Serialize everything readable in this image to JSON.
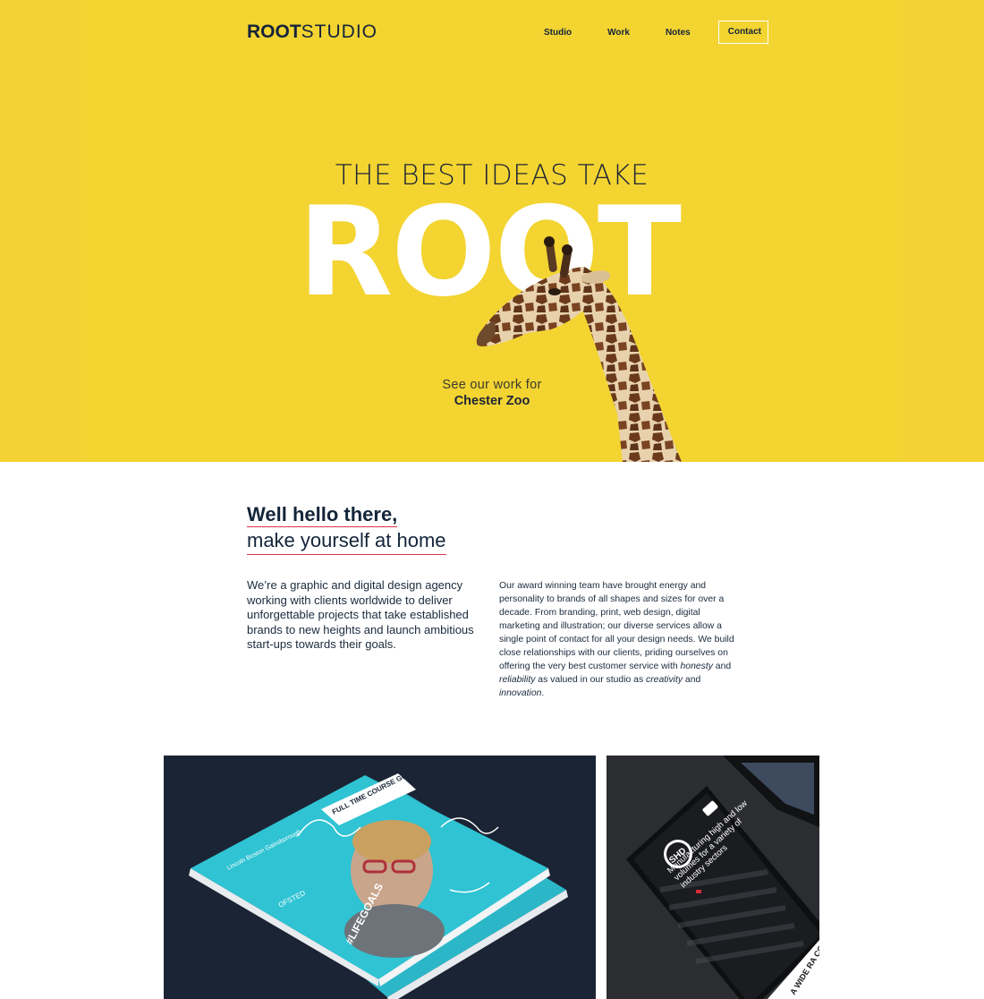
{
  "brand": {
    "logo_bold": "ROOT",
    "logo_light": "STUDIO"
  },
  "nav": {
    "items": [
      {
        "label": "Studio"
      },
      {
        "label": "Work"
      },
      {
        "label": "Notes"
      }
    ],
    "contact_label": "Contact"
  },
  "hero": {
    "tagline": "THE BEST IDEAS TAKE",
    "headline": "ROOT",
    "cta_line1": "See our work for",
    "cta_line2": "Chester Zoo",
    "background_color": "#f3d431"
  },
  "intro": {
    "heading": "Well hello there,",
    "subheading": "make yourself at home",
    "left_paragraph": "We’re a graphic and digital design agency working with clients worldwide to deliver unforgettable projects that take established brands to new heights and launch ambitious start-ups towards their goals.",
    "right_paragraph_part1": "Our award winning team have brought energy and personality to brands of all shapes and sizes for over a decade. From branding, print, web design, digital marketing and illustration; our diverse services allow a single point of contact for all your design needs. We build close relationships with our clients, priding ourselves on offering the very best customer service with ",
    "right_em1": "honesty",
    "right_and1": " and ",
    "right_em2": "reliability",
    "right_part2": " as valued in our studio as ",
    "right_em3": "creativity",
    "right_and2": " and ",
    "right_em4": "innovation",
    "right_end": "."
  },
  "work": {
    "tile1": {
      "cover_banner": "FULL TIME COURSE GUIDE",
      "cover_college": "Lincoln Boston Gainsborough",
      "cover_tag": "#LIFEGOALS",
      "cover_brand": "OFSTED"
    },
    "tile2": {
      "phone_logo": "SHD",
      "phone_headline": "Manufacturing high and low volumes for a variety of industry sectors",
      "corner_text": "A WIDE RA COMPO"
    }
  },
  "colors": {
    "accent_underline": "#d9344e",
    "navy": "#14253a",
    "yellow": "#f3d431"
  }
}
